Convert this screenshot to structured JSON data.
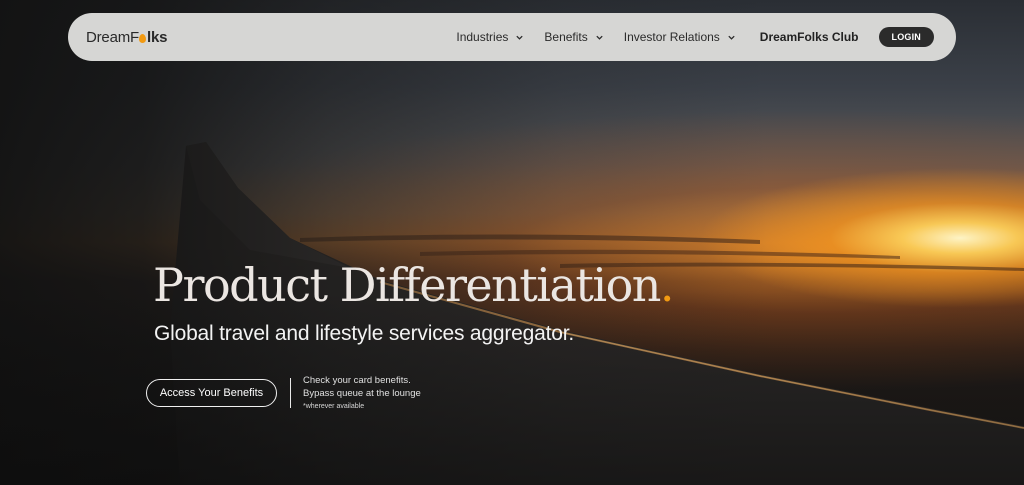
{
  "brand": {
    "logo_left": "DreamF",
    "logo_right": "lks",
    "accent_color": "#f29a12"
  },
  "nav": {
    "items": [
      {
        "label": "Industries",
        "icon": "chevron-down-icon"
      },
      {
        "label": "Benefits",
        "icon": "chevron-down-icon"
      },
      {
        "label": "Investor Relations",
        "icon": "chevron-down-icon"
      }
    ],
    "club_label": "DreamFolks Club",
    "login_label": "LOGIN"
  },
  "hero": {
    "headline": "Product Differentiation",
    "headline_dot": ".",
    "subheadline": "Global travel and lifestyle services aggregator.",
    "cta_label": "Access Your Benefits",
    "note_line1": "Check your card benefits.",
    "note_line2": "Bypass queue at the lounge",
    "note_footnote": "*wherever available"
  }
}
